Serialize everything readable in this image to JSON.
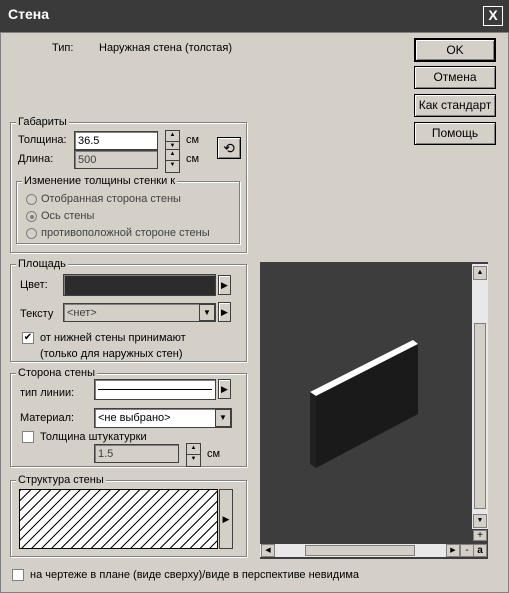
{
  "window": {
    "title": "Стена",
    "close_glyph": "X"
  },
  "type_row": {
    "label": "Тип:",
    "value": "Наружная стена (толстая)"
  },
  "buttons": {
    "ok": "OK",
    "cancel": "Отмена",
    "as_standard": "Как стандарт",
    "help": "Помощь"
  },
  "dimensions": {
    "legend": "Габариты",
    "thickness_label": "Толщина:",
    "thickness_value": "36.5",
    "length_label": "Длина:",
    "length_value": "500",
    "unit": "см",
    "change_group": {
      "legend": "Изменение толщины стенки  к",
      "options": [
        "Отобранная сторона стены",
        "Ось стены",
        "противоположной стороне стены"
      ],
      "selected_index": 1
    }
  },
  "area": {
    "legend": "Площадь",
    "color_label": "Цвет:",
    "texture_label": "Тексту",
    "texture_value": "<нет>",
    "from_lower_wall_label": "от нижней стены принимают",
    "from_lower_wall_note": "(только для наружных стен)",
    "from_lower_wall_checked": true
  },
  "wall_side": {
    "legend": "Сторона стены",
    "line_type_label": "тип линии:",
    "material_label": "Материал:",
    "material_value": "<не выбрано>",
    "plaster_label": "Толщина штукатурки",
    "plaster_checked": false,
    "plaster_value": "1.5",
    "plaster_unit": "см"
  },
  "structure": {
    "legend": "Структура стены"
  },
  "preview": {
    "corner_plus": "+",
    "corner_minus": "-",
    "corner_a": "a"
  },
  "bottom": {
    "invisible_label": "на чертеже в плане (виде сверху)/виде в перспективе невидима",
    "invisible_checked": false
  },
  "colors": {
    "titlebar": "#3a3a3a",
    "dialog_bg": "#d4d0c8",
    "preview_bg": "#3d3d3d",
    "wall_color": "#2c2c2c"
  }
}
